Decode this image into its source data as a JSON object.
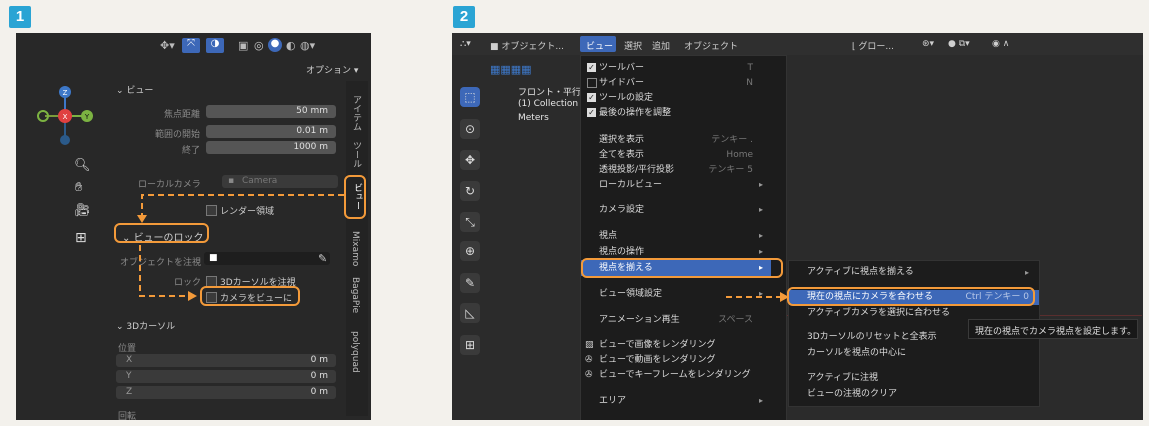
{
  "step1": {
    "number": "1"
  },
  "step2": {
    "number": "2"
  },
  "left": {
    "options_label": "オプション ▾",
    "view_section": "ビュー",
    "focal_label": "焦点距離",
    "focal_value": "50 mm",
    "clip_start_label": "範囲の開始",
    "clip_start_value": "0.01 m",
    "clip_end_label": "終了",
    "clip_end_value": "1000 m",
    "local_camera_label": "ローカルカメラ",
    "local_camera_value": "Camera",
    "render_region_label": "レンダー領域",
    "view_lock_section": "ビューのロック",
    "lock_to_object_label": "オブジェクトを注視",
    "lock_label": "ロック",
    "lock_3d_cursor_label": "3Dカーソルを注視",
    "camera_to_view_label": "カメラをビューに",
    "cursor_section": "3Dカーソル",
    "location_label": "位置",
    "x_label": "X",
    "x_value": "0 m",
    "y_label": "Y",
    "y_value": "0 m",
    "z_label": "Z",
    "z_value": "0 m",
    "rotation_label": "回転",
    "tabs": [
      "アイテム",
      "ツール",
      "ビュー",
      "Mixamo",
      "BagaPie",
      "polyquad"
    ],
    "gizmo": {
      "z": "Z",
      "x": "X",
      "y": "Y"
    }
  },
  "right": {
    "header": {
      "mode": "オブジェクト...",
      "menus": [
        "ビュー",
        "選択",
        "追加",
        "オブジェクト"
      ],
      "transform": "グロー..."
    },
    "overlay": {
      "line1": "フロント・平行投影",
      "line2": "(1) Collection | C",
      "line3": "Meters"
    },
    "view_menu": [
      {
        "label": "ツールバー",
        "shortcut": "T",
        "check": true
      },
      {
        "label": "サイドバー",
        "shortcut": "N",
        "check": false
      },
      {
        "label": "ツールの設定",
        "shortcut": "",
        "check": true
      },
      {
        "label": "最後の操作を調整",
        "shortcut": "",
        "check": true
      },
      {
        "label": "選択を表示",
        "shortcut": "テンキー ."
      },
      {
        "label": "全てを表示",
        "shortcut": "Home"
      },
      {
        "label": "透視投影/平行投影",
        "shortcut": "テンキー 5"
      },
      {
        "label": "ローカルビュー",
        "shortcut": "",
        "arrow": true
      },
      {
        "label": "カメラ設定",
        "shortcut": "",
        "arrow": true
      },
      {
        "label": "視点",
        "shortcut": "",
        "arrow": true
      },
      {
        "label": "視点の操作",
        "shortcut": "",
        "arrow": true
      },
      {
        "label": "視点を揃える",
        "shortcut": "",
        "arrow": true
      },
      {
        "label": "ビュー領域設定",
        "shortcut": "",
        "arrow": true
      },
      {
        "label": "アニメーション再生",
        "shortcut": "スペース"
      },
      {
        "label": "ビューで画像をレンダリング",
        "shortcut": ""
      },
      {
        "label": "ビューで動画をレンダリング",
        "shortcut": ""
      },
      {
        "label": "ビューでキーフレームをレンダリング",
        "shortcut": ""
      },
      {
        "label": "エリア",
        "shortcut": "",
        "arrow": true
      }
    ],
    "submenu": {
      "align_active": "アクティブに視点を揃える",
      "align_camera": "現在の視点にカメラを合わせる",
      "align_camera_shortcut": "Ctrl テンキー 0",
      "active_camera_to_selected": "アクティブカメラを選択に合わせる",
      "reset_cursor": "3Dカーソルのリセットと全表示",
      "center_cursor": "カーソルを視点の中心に",
      "look_at_active": "アクティブに注視",
      "clear_look": "ビューの注視のクリア"
    },
    "tooltip": "現在の視点でカメラ視点を設定します。"
  },
  "colors": {
    "accent": "#f39a3a",
    "highlight": "#3d68b8",
    "badge": "#2aa4d4"
  }
}
